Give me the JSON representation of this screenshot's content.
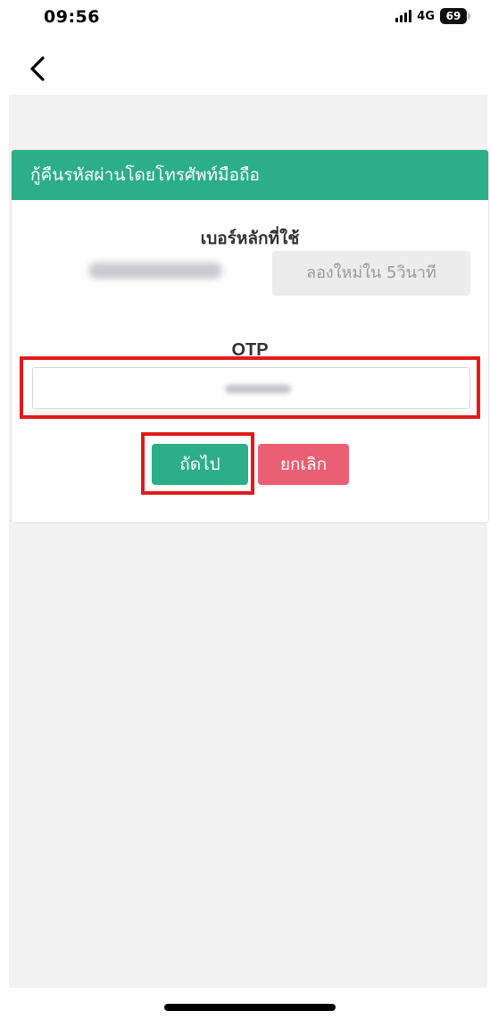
{
  "status_bar": {
    "time": "09:56",
    "network": "4G",
    "battery": "69",
    "signal_icon": "signal-bars-icon"
  },
  "nav": {
    "back_icon": "chevron-left-icon"
  },
  "card": {
    "title": "กู้คืนรหัสผ่านโดยโทรศัพท์มือถือ",
    "phone_label": "เบอร์หลักที่ใช้",
    "retry_label": "ลองใหม่ใน 5วินาที",
    "otp_label": "OTP",
    "next_label": "ถัดไป",
    "cancel_label": "ยกเลิก"
  },
  "colors": {
    "primary": "#2cae88",
    "danger": "#ea5f73",
    "highlight": "#e11b1b",
    "background": "#f2f2f3"
  }
}
